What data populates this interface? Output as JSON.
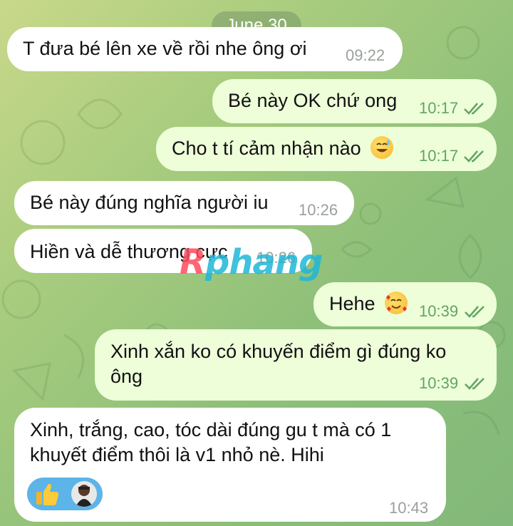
{
  "date_separator": "June 30",
  "messages": [
    {
      "text": "T đưa bé lên xe về rồi nhe ông ơi",
      "time": "09:22",
      "direction": "incoming"
    },
    {
      "text": "Bé này OK chứ ong",
      "time": "10:17",
      "direction": "outgoing",
      "read": true
    },
    {
      "text": "Cho t tí cảm nhận nào",
      "emoji": "sweat-smile-emoji",
      "time": "10:17",
      "direction": "outgoing",
      "read": true
    },
    {
      "text": "Bé này đúng nghĩa người iu",
      "time": "10:26",
      "direction": "incoming"
    },
    {
      "text": "Hiền và dễ thương cực",
      "time": "10:26",
      "direction": "incoming"
    },
    {
      "text": "Hehe",
      "emoji": "smiling-face-with-hearts-emoji",
      "time": "10:39",
      "direction": "outgoing",
      "read": true
    },
    {
      "line1": "Xinh xắn ko có khuyến điểm gì đúng ko",
      "line2": "ông",
      "time": "10:39",
      "direction": "outgoing",
      "read": true
    },
    {
      "line1": "Xinh, trắng, cao, tóc dài đúng gu t mà có 1",
      "line2": "khuyết điểm thôi là v1 nhỏ nè. Hihi",
      "time": "10:43",
      "direction": "incoming",
      "reaction": {
        "emoji": "thumbs-up-icon",
        "avatar": "reactor-avatar"
      }
    }
  ],
  "watermark": {
    "first": "R",
    "rest": "phang"
  },
  "colors": {
    "incoming_bubble": "#ffffff",
    "outgoing_bubble": "#eefed9",
    "outgoing_meta": "#62a561",
    "reaction_pill": "#5cb4e8"
  }
}
